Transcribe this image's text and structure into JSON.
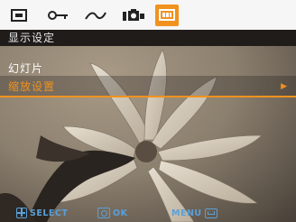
{
  "tabs": [
    {
      "icon": "playback-icon",
      "active": false
    },
    {
      "icon": "key-icon",
      "active": false
    },
    {
      "icon": "curve-icon",
      "active": false
    },
    {
      "icon": "camera-icon",
      "active": false
    },
    {
      "icon": "display-icon",
      "active": true
    }
  ],
  "menu": {
    "title": "显示设定",
    "items": [
      {
        "label": "幻灯片",
        "selected": false
      },
      {
        "label": "缩放设置",
        "selected": true
      }
    ]
  },
  "footer": {
    "select_label": "SELECT",
    "ok_label": "OK",
    "menu_label": "MENU"
  },
  "colors": {
    "accent": "#f1921e",
    "hint": "#5aa0d8",
    "title_bar": "#1f1c1a"
  }
}
